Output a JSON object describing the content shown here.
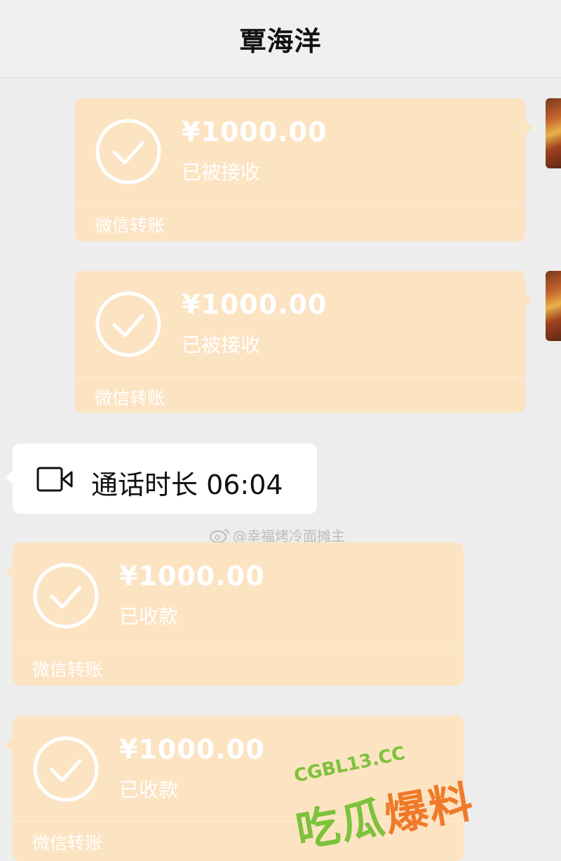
{
  "header": {
    "title": "覃海洋"
  },
  "messages": [
    {
      "amount": "¥1000.00",
      "status": "已被接收",
      "footer": "微信转账"
    },
    {
      "amount": "¥1000.00",
      "status": "已被接收",
      "footer": "微信转账"
    },
    {
      "amount": "¥1000.00",
      "status": "已收款",
      "footer": "微信转账"
    },
    {
      "amount": "¥1000.00",
      "status": "已收款",
      "footer": "微信转账"
    }
  ],
  "call": {
    "label": "通话时长 06:04",
    "icon": "video-camera-icon"
  },
  "watermark": {
    "text": "@幸福烤冷面摊主",
    "icon": "weibo-icon"
  },
  "site_watermark": {
    "domain": "CGBL13.CC",
    "chars": "吃瓜爆料"
  },
  "colors": {
    "transfer_bg": "#fce3c2",
    "chat_bg": "#ededed",
    "call_bg": "#ffffff"
  }
}
